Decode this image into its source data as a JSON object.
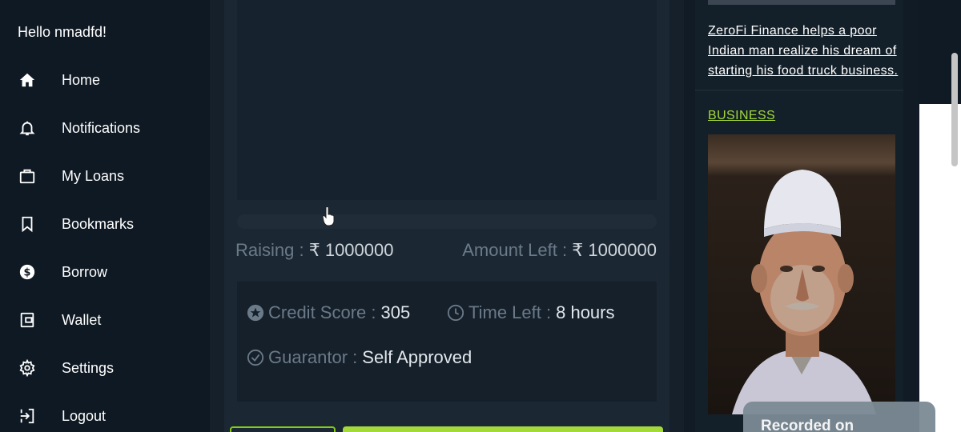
{
  "sidebar": {
    "greeting": "Hello nmadfd!",
    "items": [
      {
        "label": "Home",
        "icon": "home-icon"
      },
      {
        "label": "Notifications",
        "icon": "bell-icon"
      },
      {
        "label": "My Loans",
        "icon": "briefcase-icon"
      },
      {
        "label": "Bookmarks",
        "icon": "bookmark-icon"
      },
      {
        "label": "Borrow",
        "icon": "dollar-coin-icon"
      },
      {
        "label": "Wallet",
        "icon": "wallet-icon"
      },
      {
        "label": "Settings",
        "icon": "gear-icon"
      },
      {
        "label": "Logout",
        "icon": "logout-icon"
      }
    ]
  },
  "loan": {
    "progress_fraction": 0,
    "raising_label": "Raising :",
    "raising_value": "₹ 1000000",
    "amount_left_label": "Amount Left :",
    "amount_left_value": "₹ 1000000",
    "credit_score_label": "Credit Score :",
    "credit_score_value": "305",
    "time_left_label": "Time Left :",
    "time_left_value": "8 hours",
    "guarantor_label": "Guarantor :",
    "guarantor_value": "Self Approved"
  },
  "news": {
    "article_title": "ZeroFi Finance helps a poor Indian man realize his dream of starting his food truck business.",
    "category": "BUSINESS"
  },
  "overlay": {
    "recorded_text": "Recorded on"
  },
  "colors": {
    "accent": "#a3d939",
    "background": "#0f1a24"
  }
}
